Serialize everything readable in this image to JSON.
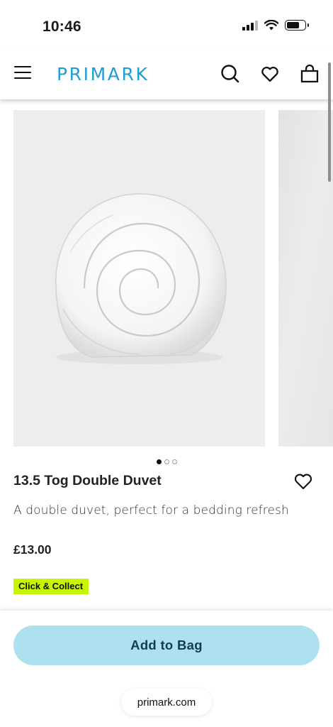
{
  "status_bar": {
    "time": "10:46"
  },
  "header": {
    "logo": "PRIMARK",
    "icons": [
      "menu-icon",
      "search-icon",
      "heart-icon",
      "bag-icon"
    ]
  },
  "gallery": {
    "image_count": 3,
    "active_index": 0
  },
  "product": {
    "title": "13.5 Tog Double Duvet",
    "description": "A double duvet, perfect for a bedding refresh",
    "price": "£13.00",
    "badge": "Click & Collect"
  },
  "actions": {
    "add_to_bag": "Add to Bag"
  },
  "browser": {
    "url": "primark.com"
  },
  "colors": {
    "brand": "#1c9fd6",
    "button": "#aee1f0",
    "button_text": "#123a52",
    "badge": "#c6f700"
  }
}
